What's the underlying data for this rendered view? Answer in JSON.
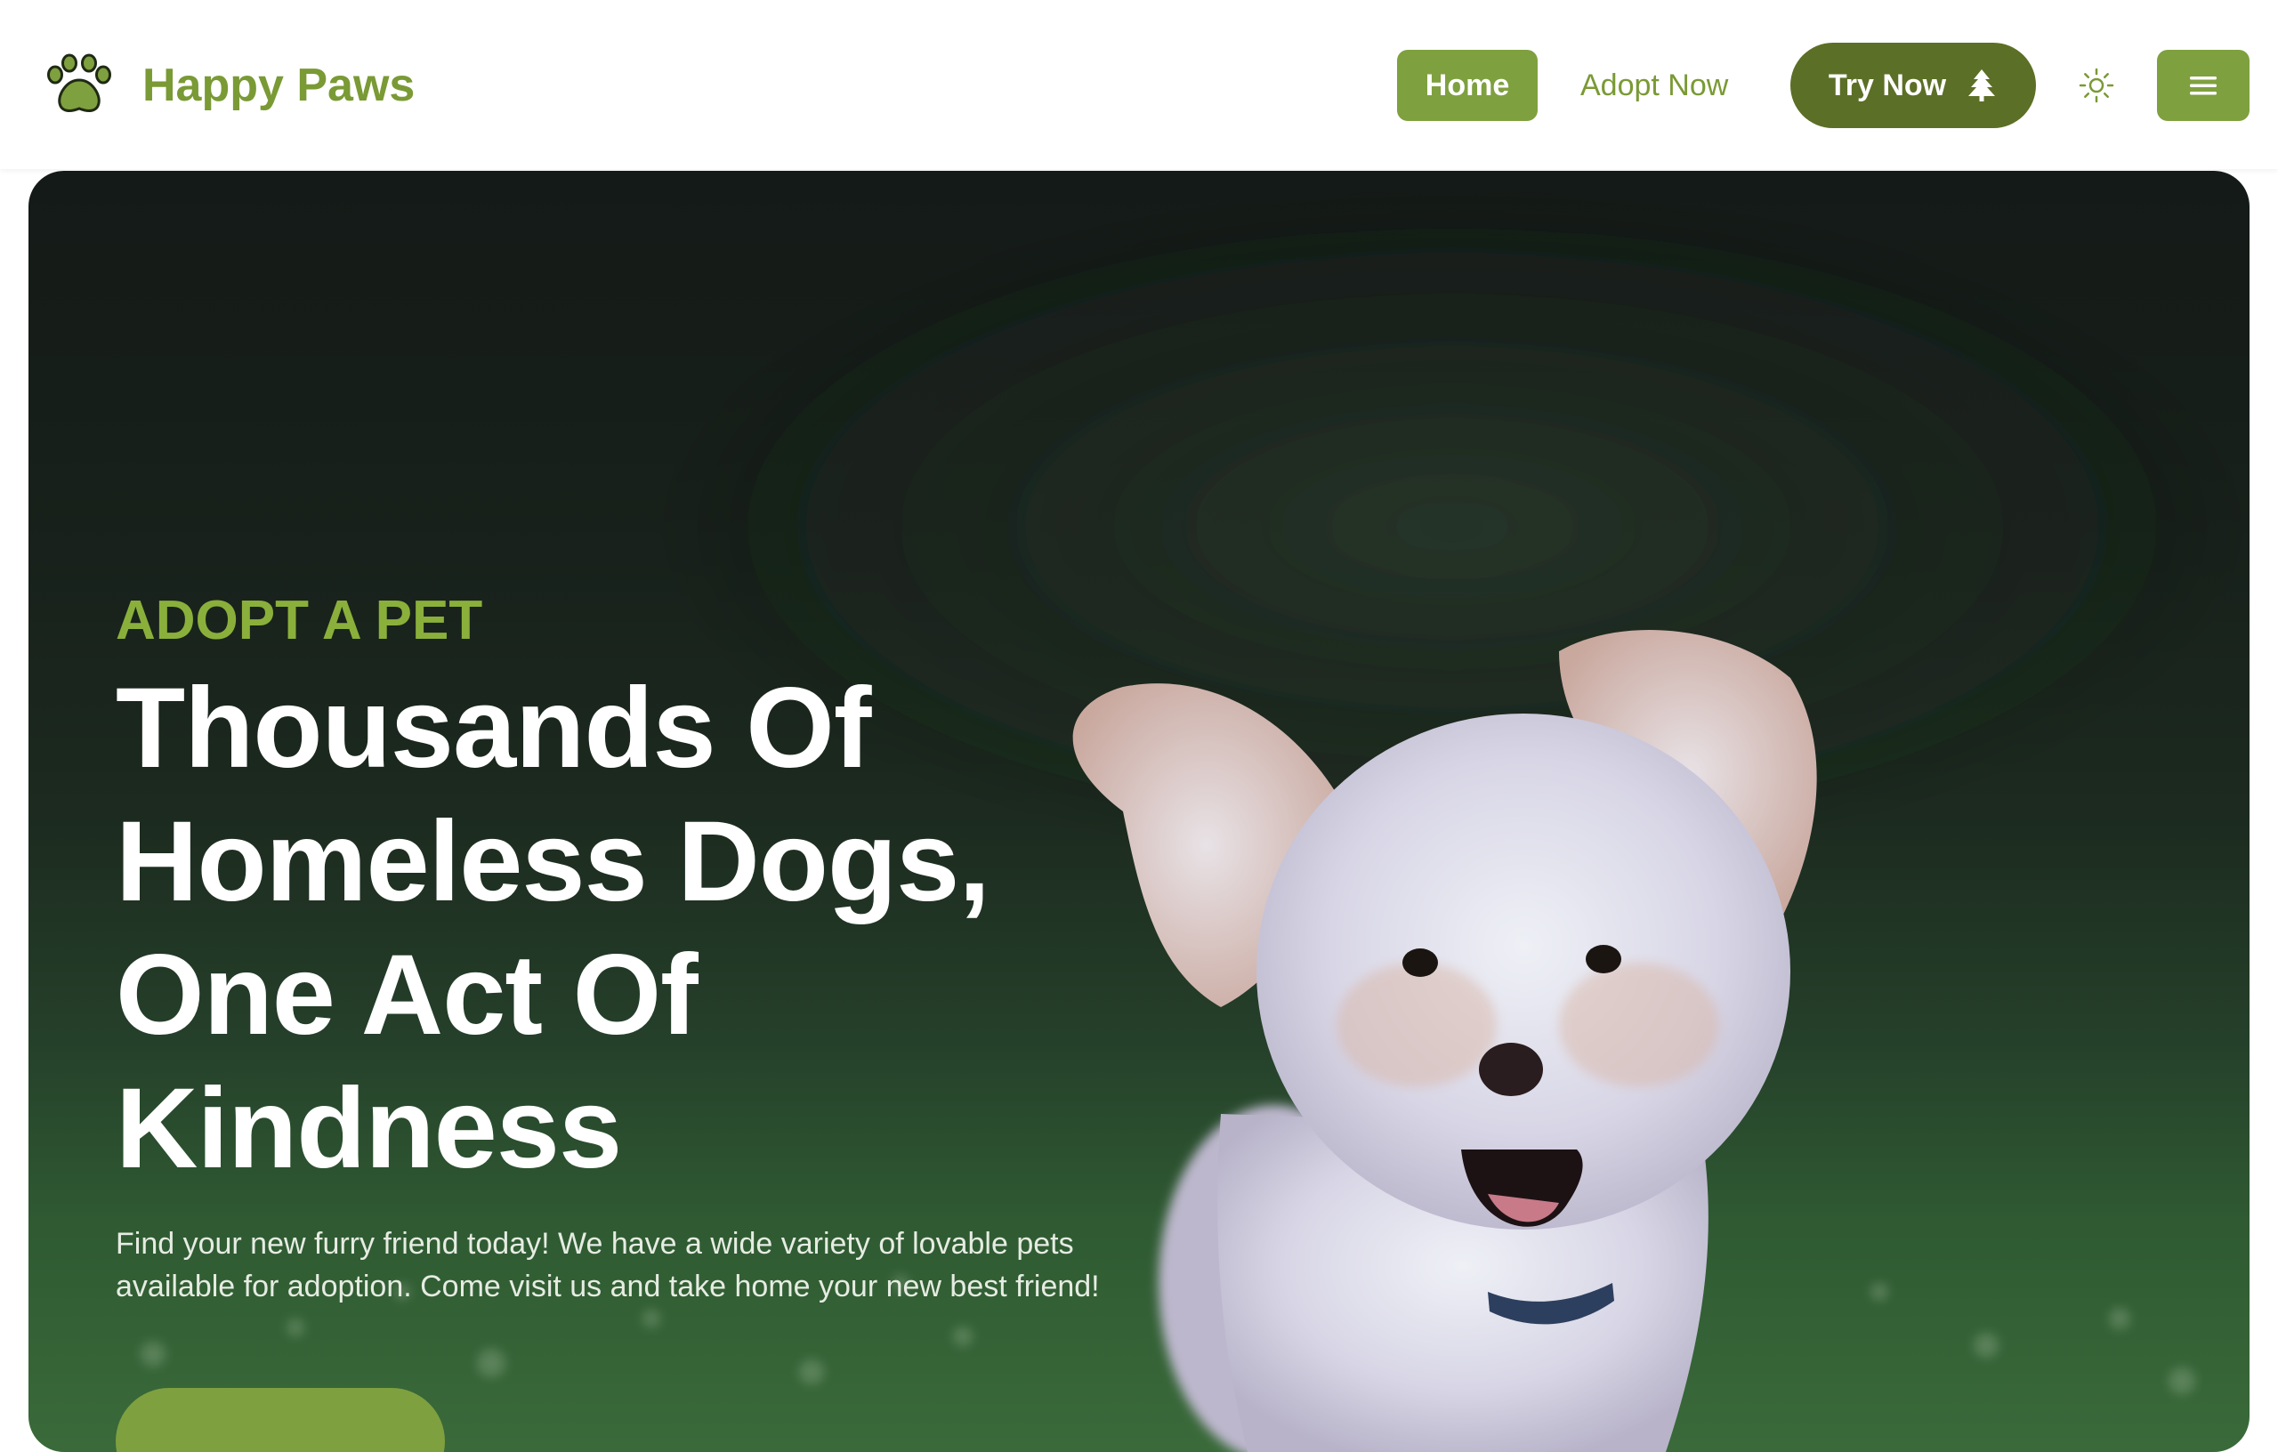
{
  "colors": {
    "brand_green": "#7fa03f",
    "dark_olive": "#5c6f26",
    "eyebrow_green": "#8ab03b",
    "hero_text": "#ffffff"
  },
  "header": {
    "brand": {
      "name": "Happy Paws",
      "icon": "paw-icon"
    },
    "nav": {
      "home_label": "Home",
      "adopt_label": "Adopt Now",
      "try_label": "Try Now",
      "try_icon": "tree-icon",
      "theme_icon": "sun-icon",
      "menu_icon": "hamburger-menu-icon"
    }
  },
  "hero": {
    "eyebrow": "ADOPT A PET",
    "title_lines": [
      "Thousands Of",
      "Homeless Dogs,",
      "One Act Of",
      "Kindness"
    ],
    "description": "Find your new furry friend today! We have a wide variety of lovable pets available for adoption. Come visit us and take home your new best friend!",
    "image": "running-white-poodle-dog-photo"
  }
}
